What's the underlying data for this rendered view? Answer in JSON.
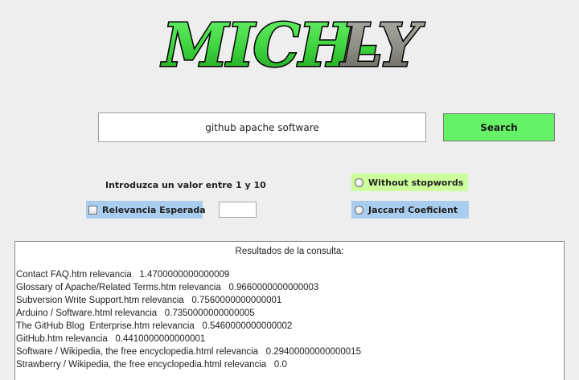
{
  "app": {
    "logo_text": "MICH-LY",
    "colors": {
      "logo_green": "#3fd83f",
      "logo_gray": "#8c8c84",
      "search_button": "#66f266",
      "option_blue": "#a9cdee",
      "option_green": "#cdff9c"
    }
  },
  "search": {
    "query": "github apache software",
    "button_label": "Search"
  },
  "options": {
    "hint": "Introduzca un valor entre 1 y 10",
    "relevance_label": "Relevancia Esperada",
    "relevance_checked": false,
    "relevance_value": "",
    "without_stopwords_label": "Without stopwords",
    "jaccard_label": "Jaccard Coeficient"
  },
  "results": {
    "title": "Resultados de la consulta:",
    "rows": [
      "Contact FAQ.htm relevancia   1.4700000000000009",
      "Glossary of Apache/Related Terms.htm relevancia   0.9660000000000003",
      "Subversion Write Support.htm relevancia   0.7560000000000001",
      "Arduino / Software.html relevancia   0.7350000000000005",
      "The GitHub Blog  Enterprise.htm relevancia   0.5460000000000002",
      "GitHub.htm relevancia   0.4410000000000001",
      "Software / Wikipedia, the free encyclopedia.html relevancia   0.29400000000000015",
      "Strawberry / Wikipedia, the free encyclopedia.html relevancia   0.0"
    ]
  }
}
